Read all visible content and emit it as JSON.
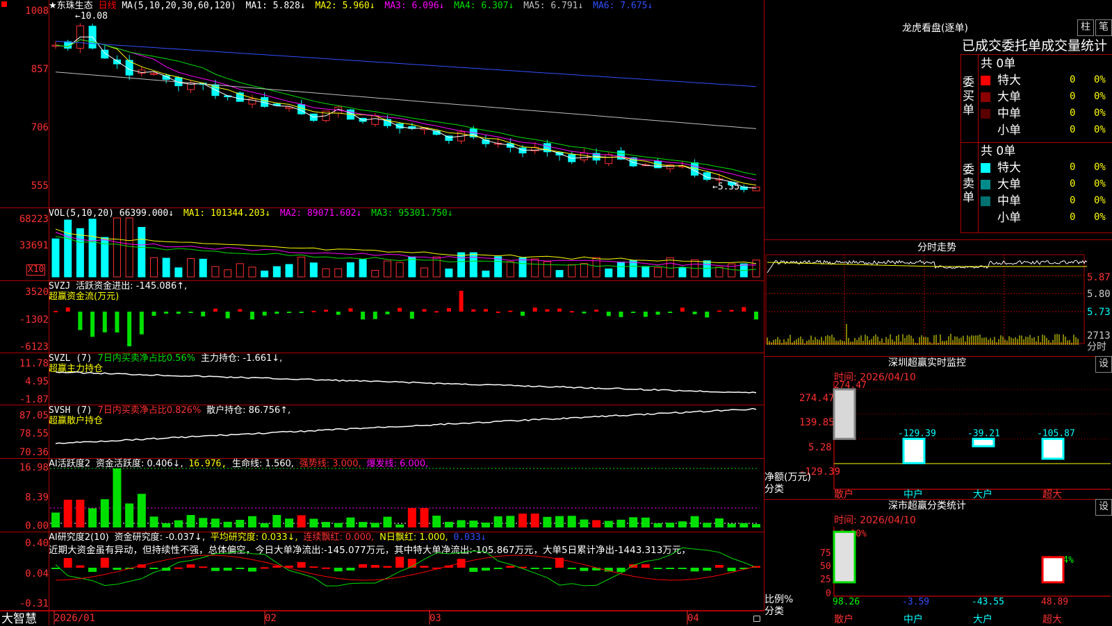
{
  "chart": {
    "stock_name": "★东珠生态",
    "period": "日线",
    "ma_title": "MA(5,10,20,30,60,120)",
    "ma_values": [
      {
        "label": "MA1: 5.828↓",
        "color": "#ffffff"
      },
      {
        "label": "MA2: 5.960↓",
        "color": "#ffff00"
      },
      {
        "label": "MA3: 6.096↓",
        "color": "#ff00ff"
      },
      {
        "label": "MA4: 6.307↓",
        "color": "#00e000"
      },
      {
        "label": "MA5: 6.791↓",
        "color": "#c0c0c0"
      },
      {
        "label": "MA6: 7.675↓",
        "color": "#3050ff"
      }
    ],
    "high_label": "10.08",
    "low_label": "5.55",
    "price_axis": [
      "1008",
      "857",
      "706",
      "555"
    ],
    "x_labels": [
      "2026/01",
      "02",
      "03",
      "04"
    ]
  },
  "vol": {
    "title": "VOL(5,10,20)",
    "value": "66399.000↓",
    "items": [
      {
        "label": "MA1: 101344.203↓",
        "color": "#ffff00"
      },
      {
        "label": "MA2: 89071.602↓",
        "color": "#ff00ff"
      },
      {
        "label": "MA3: 95301.750↓",
        "color": "#00e000"
      }
    ],
    "axis": [
      "68223",
      "33691"
    ],
    "unit": "X10"
  },
  "svzj": {
    "title": "SVZJ",
    "line1": "活跃资金进出: -145.086↑,",
    "line2": "超赢资金流(万元)",
    "axis": [
      "3520",
      "-1302",
      "-6123"
    ]
  },
  "svzl": {
    "title": "SVZL (7)",
    "part1": "7日内买卖净占比0.56%",
    "part2": "主力持仓: -1.661↓,",
    "line2": "超赢主力持仓",
    "axis": [
      "11.78",
      "4.95",
      "-1.87"
    ]
  },
  "svsh": {
    "title": "SVSH (7)",
    "part1": "7日内买卖净占比0.826%",
    "part2": "散户持仓: 86.756↑,",
    "line2": "超赢散户持仓",
    "axis": [
      "87.05",
      "78.55",
      "70.36"
    ]
  },
  "ai1": {
    "title": "AI活跃度2",
    "part1": "资金活跃度: 0.406↓,",
    "part2": "16.976,",
    "part3": "生命线: 1.560,",
    "part4": "强势线: 3.000,",
    "part5": "爆发线: 6.000,",
    "axis": [
      "16.98",
      "8.39",
      "0.00"
    ]
  },
  "ai2": {
    "title": "AI研究度2(10)",
    "part1": "资金研究度: -0.037↓,",
    "part2": "平均研究度: 0.033↓,",
    "part3": "连续飘红: 0.000,",
    "part4": "N日飘红: 1.000,",
    "part5": "0.033↓",
    "commentary": "近期大资金虽有异动，但持续性不强，总体偏空，今日大单净流出:-145.077万元，其中特大单净流出:-105.867万元，大单5日累计净出-1443.313万元，",
    "axis": [
      "0.40",
      "0.04",
      "-0.31"
    ]
  },
  "brand": "大智慧",
  "right": {
    "longhu": {
      "title": "龙虎看盘(逐单)",
      "btn1": "柱",
      "btn2": "笔",
      "subtitle": "已成交委托单成交量统计",
      "buy_label": "委买单",
      "sell_label": "委卖单",
      "buy_total": "共 0单",
      "sell_total": "共 0单",
      "buy_rows": [
        {
          "name": "特大",
          "count": "0",
          "pct": "0%",
          "color": "#ff0000"
        },
        {
          "name": "大单",
          "count": "0",
          "pct": "0%",
          "color": "#8b0000"
        },
        {
          "name": "中单",
          "count": "0",
          "pct": "0%",
          "color": "#5a0000"
        },
        {
          "name": "小单",
          "count": "0",
          "pct": "0%",
          "color": "#000000"
        }
      ],
      "sell_rows": [
        {
          "name": "特大",
          "count": "0",
          "pct": "0%",
          "color": "#00ffff"
        },
        {
          "name": "大单",
          "count": "0",
          "pct": "0%",
          "color": "#008b8b"
        },
        {
          "name": "中单",
          "count": "0",
          "pct": "0%",
          "color": "#007070"
        },
        {
          "name": "小单",
          "count": "0",
          "pct": "0%",
          "color": "#000000"
        }
      ]
    },
    "fenshi": {
      "title": "分时走势",
      "axis": [
        "5.87",
        "5.80",
        "5.73"
      ],
      "vol_label": "2713",
      "vol_unit": "分时"
    },
    "sz_monitor": {
      "title": "深圳超赢实时监控",
      "settings": "设",
      "time": "时间: 2026/04/10",
      "axis": [
        "274.47",
        "139.85",
        "5.28",
        "-129.39"
      ],
      "axis_title": "净额(万元)",
      "axis_sub": "分类",
      "chart_data": {
        "type": "bar",
        "categories": [
          "散户",
          "中户",
          "大户",
          "超大"
        ],
        "values": [
          274.47,
          -129.39,
          -39.21,
          -105.87
        ],
        "ylim": [
          -129.39,
          274.47
        ]
      },
      "value_labels": [
        "274.47",
        "-129.39",
        "-39.21",
        "-105.87"
      ]
    },
    "sz_stats": {
      "title": "深市超赢分类统计",
      "settings": "设",
      "time": "时间: 2026/04/10",
      "top_labels": [
        "+0.10%",
        "-0.04%"
      ],
      "axis": [
        "75",
        "50",
        "25",
        "0"
      ],
      "axis_title": "比例%",
      "axis_sub": "分类",
      "chart_data": {
        "type": "bar",
        "categories": [
          "散户",
          "中户",
          "大户",
          "超大"
        ],
        "values": [
          98.26,
          -3.59,
          -43.55,
          48.89
        ],
        "ylim": [
          0,
          100
        ]
      },
      "value_labels": [
        "98.26",
        "-3.59",
        "-43.55",
        "48.89"
      ]
    }
  }
}
